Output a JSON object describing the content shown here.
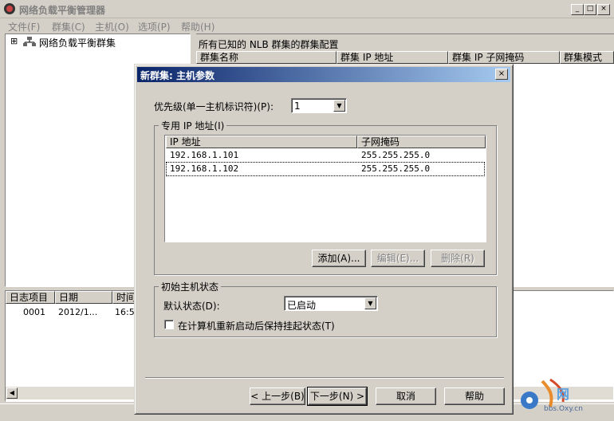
{
  "window": {
    "title": "网络负载平衡管理器",
    "min": "_",
    "max": "□",
    "close": "×"
  },
  "menu": [
    "文件(F)",
    "群集(C)",
    "主机(O)",
    "选项(P)",
    "帮助(H)"
  ],
  "tree": {
    "root_label": "网络负载平衡群集",
    "expander": "⊞"
  },
  "right_pane": {
    "caption": "所有已知的 NLB 群集的群集配置",
    "columns": [
      "群集名称",
      "群集 IP 地址",
      "群集 IP 子网掩码",
      "群集模式"
    ]
  },
  "log": {
    "columns": [
      "日志项目",
      "日期",
      "时间"
    ],
    "rows": [
      {
        "entry": "0001",
        "date": "2012/1...",
        "time": "16:5"
      }
    ]
  },
  "dialog": {
    "title": "新群集:  主机参数",
    "close": "×",
    "priority_label": "优先级(单一主机标识符)(P):",
    "priority_value": "1",
    "dedicated_ip_group": "专用 IP 地址(I)",
    "ip_columns": [
      "IP 地址",
      "子网掩码"
    ],
    "ip_rows": [
      {
        "ip": "192.168.1.101",
        "mask": "255.255.255.0"
      },
      {
        "ip": "192.168.1.102",
        "mask": "255.255.255.0"
      }
    ],
    "add_button": "添加(A)...",
    "edit_button": "编辑(E)...",
    "remove_button": "删除(R)",
    "initial_state_group": "初始主机状态",
    "default_state_label": "默认状态(D):",
    "default_state_value": "已启动",
    "keep_suspended_label": "在计算机重新启动后保持挂起状态(T)",
    "back_button": "< 上一步(B)",
    "next_button": "下一步(N) >",
    "cancel_button": "取消",
    "help_button": "帮助"
  },
  "watermark": {
    "site": "bbs.Oxy.cn"
  }
}
